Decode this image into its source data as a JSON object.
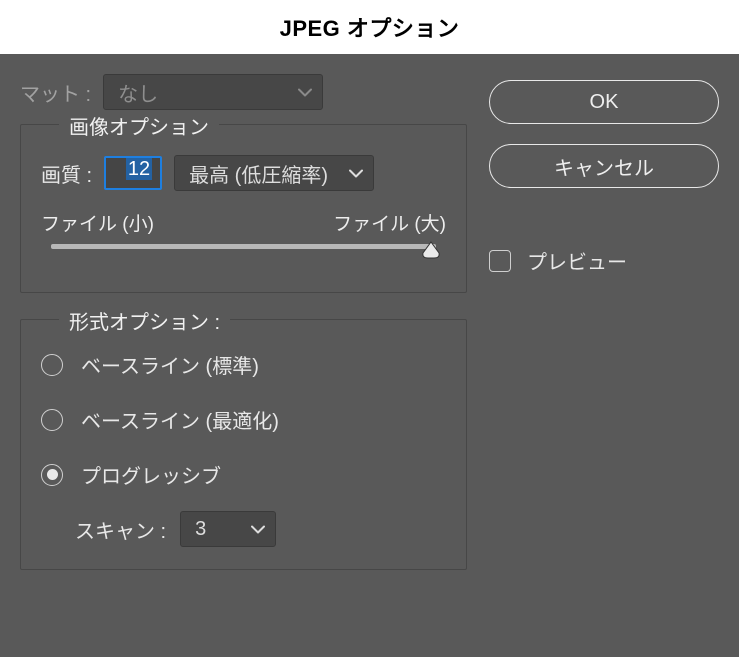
{
  "title": "JPEG オプション",
  "matte": {
    "label": "マット :",
    "value": "なし"
  },
  "image_options": {
    "legend": "画像オプション",
    "quality_label": "画質 :",
    "quality_value": "12",
    "preset": "最高 (低圧縮率)",
    "file_small": "ファイル (小)",
    "file_large": "ファイル (大)"
  },
  "format_options": {
    "legend": "形式オプション :",
    "radios": {
      "baseline_standard": "ベースライン (標準)",
      "baseline_optimized": "ベースライン (最適化)",
      "progressive": "プログレッシブ"
    },
    "selected": "progressive",
    "scan_label": "スキャン :",
    "scan_value": "3"
  },
  "buttons": {
    "ok": "OK",
    "cancel": "キャンセル"
  },
  "preview": {
    "label": "プレビュー",
    "checked": false
  }
}
